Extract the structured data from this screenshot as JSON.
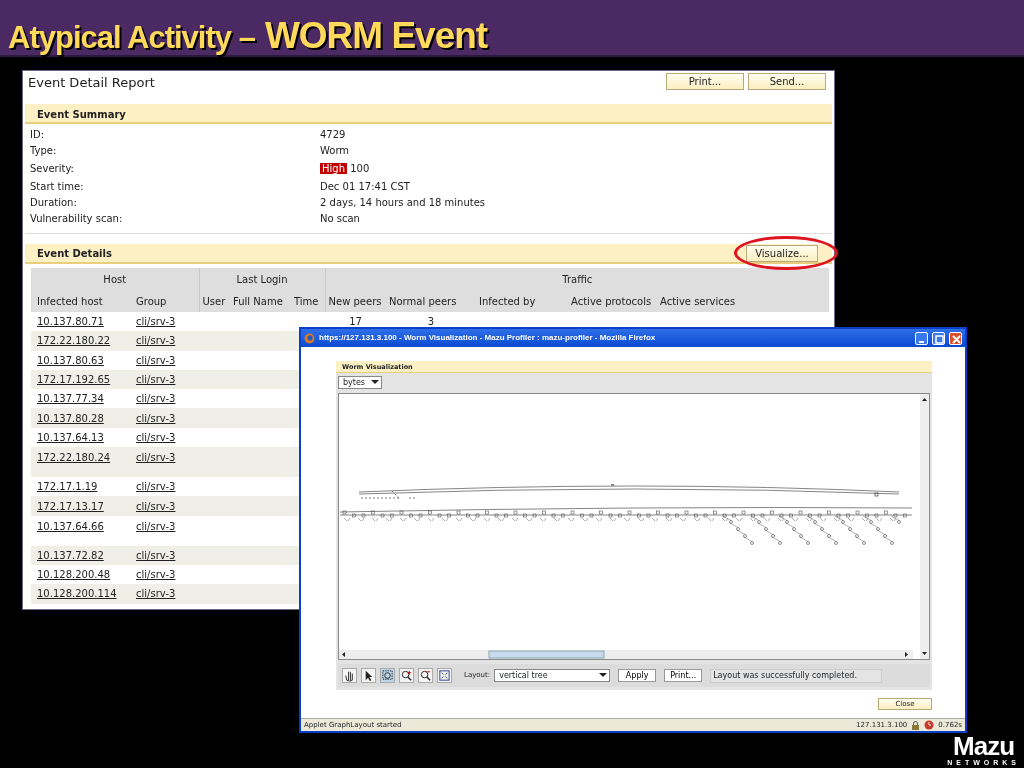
{
  "slide": {
    "title_prefix": "Atypical Activity –",
    "title_main": "WORM Event",
    "logo": "Mazu",
    "logo_sub": "NETWORKS"
  },
  "report": {
    "title": "Event Detail Report",
    "buttons": [
      "Print...",
      "Send..."
    ],
    "summary": {
      "heading": "Event Summary",
      "fields": [
        {
          "label": "ID:",
          "value": "4729"
        },
        {
          "label": "Type:",
          "value": "Worm"
        },
        {
          "label": "Severity:",
          "badge": "High",
          "value": "100"
        },
        {
          "label": "Start time:",
          "value": "Dec 01 17:41 CST"
        },
        {
          "label": "Duration:",
          "value": "2 days, 14 hours and 18 minutes"
        },
        {
          "label": "Vulnerability scan:",
          "value": "No scan"
        }
      ]
    },
    "details": {
      "heading": "Event Details",
      "button": {
        "label": "Visualize...",
        "highlighted": true
      },
      "groups": [
        {
          "label": "Host",
          "columns": [
            "Infected host",
            "Group"
          ]
        },
        {
          "label": "Last Login",
          "columns": [
            "User",
            "Full Name",
            "Time"
          ]
        },
        {
          "label": "Traffic",
          "columns": [
            "New peers",
            "Normal peers",
            "Infected by",
            "Active protocols",
            "Active services"
          ]
        }
      ],
      "rows": [
        {
          "host": "10.137.80.71",
          "group": "cli/srv-3",
          "new_peers": "17",
          "normal_peers": "3"
        },
        {
          "host": "172.22.180.22",
          "group": "cli/srv-3"
        },
        {
          "host": "10.137.80.63",
          "group": "cli/srv-3"
        },
        {
          "host": "172.17.192.65",
          "group": "cli/srv-3"
        },
        {
          "host": "10.137.77.34",
          "group": "cli/srv-3"
        },
        {
          "host": "10.137.80.28",
          "group": "cli/srv-3"
        },
        {
          "host": "10.137.64.13",
          "group": "cli/srv-3"
        },
        {
          "host": "172.22.180.24",
          "group": "cli/srv-3",
          "tall": true
        },
        {
          "host": "172.17.1.19",
          "group": "cli/srv-3"
        },
        {
          "host": "172.17.13.17",
          "group": "cli/srv-3"
        },
        {
          "host": "10.137.64.66",
          "group": "cli/srv-3",
          "tall": true
        },
        {
          "host": "10.137.72.82",
          "group": "cli/srv-3"
        },
        {
          "host": "10.128.200.48",
          "group": "cli/srv-3"
        },
        {
          "host": "10.128.200.114",
          "group": "cli/srv-3"
        }
      ]
    }
  },
  "popup": {
    "title": "https://127.131.3.100 - Worm Visualization - Mazu Profiler : mazu-profiler - Mozilla Firefox",
    "panel_heading": "Worm Visualization",
    "metric": "bytes",
    "tools": [
      {
        "kind": "hand",
        "selected": false
      },
      {
        "kind": "pointer",
        "selected": false
      },
      {
        "kind": "zoom-box",
        "selected": true
      },
      {
        "kind": "zoom-in",
        "selected": false
      },
      {
        "kind": "zoom-out",
        "selected": false
      },
      {
        "kind": "fit",
        "selected": false
      }
    ],
    "layout_label": "Layout:",
    "layout_value": "vertical tree",
    "buttons": [
      "Apply",
      "Print..."
    ],
    "message": "Layout was successfully completed.",
    "close": "Close",
    "status": "Applet GraphLayout started",
    "status_host": "127.131.3.100",
    "status_time": "0.762s"
  }
}
